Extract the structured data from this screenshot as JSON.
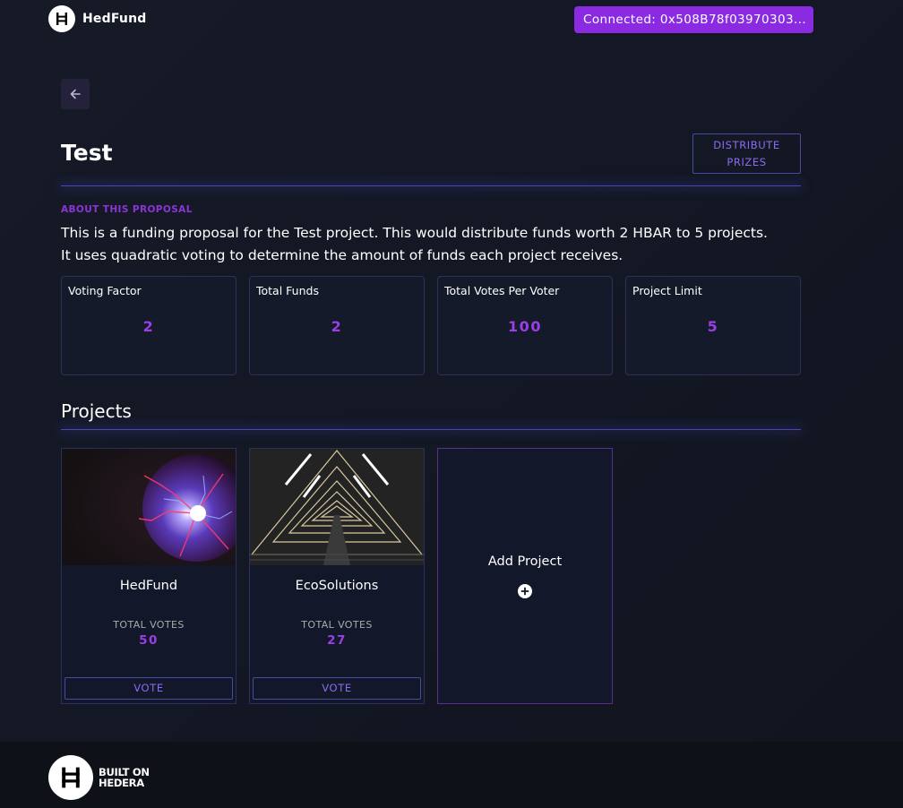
{
  "header": {
    "app_name": "HedFund",
    "connected_label": "Connected: 0x508B78f03970303..."
  },
  "proposal": {
    "title": "Test",
    "distribute_label_line1": "DISTRIBUTE",
    "distribute_label_line2": "PRIZES",
    "about_label": "ABOUT THIS PROPOSAL",
    "about_line1": "This is a funding proposal for the Test project. This would distribute funds worth 2 HBAR to 5 projects.",
    "about_line2": "It uses quadratic voting to determine the amount of funds each project receives."
  },
  "stats": [
    {
      "label": "Voting Factor",
      "value": "2"
    },
    {
      "label": "Total Funds",
      "value": "2"
    },
    {
      "label": "Total Votes Per Voter",
      "value": "100"
    },
    {
      "label": "Project Limit",
      "value": "5"
    }
  ],
  "projects_heading": "Projects",
  "projects": [
    {
      "name": "HedFund",
      "votes_label": "TOTAL VOTES",
      "votes": "50",
      "vote_label": "VOTE"
    },
    {
      "name": "EcoSolutions",
      "votes_label": "TOTAL VOTES",
      "votes": "27",
      "vote_label": "VOTE"
    }
  ],
  "add_project_label": "Add Project",
  "footer": {
    "line1": "BUILT ON",
    "line2": "HEDERA"
  },
  "colors": {
    "accent": "#8a2be2",
    "value_purple": "#9a3fe6",
    "background": "#131722"
  },
  "icons": [
    "hedera-logo-icon",
    "back-arrow-icon",
    "plus-circle-icon"
  ]
}
